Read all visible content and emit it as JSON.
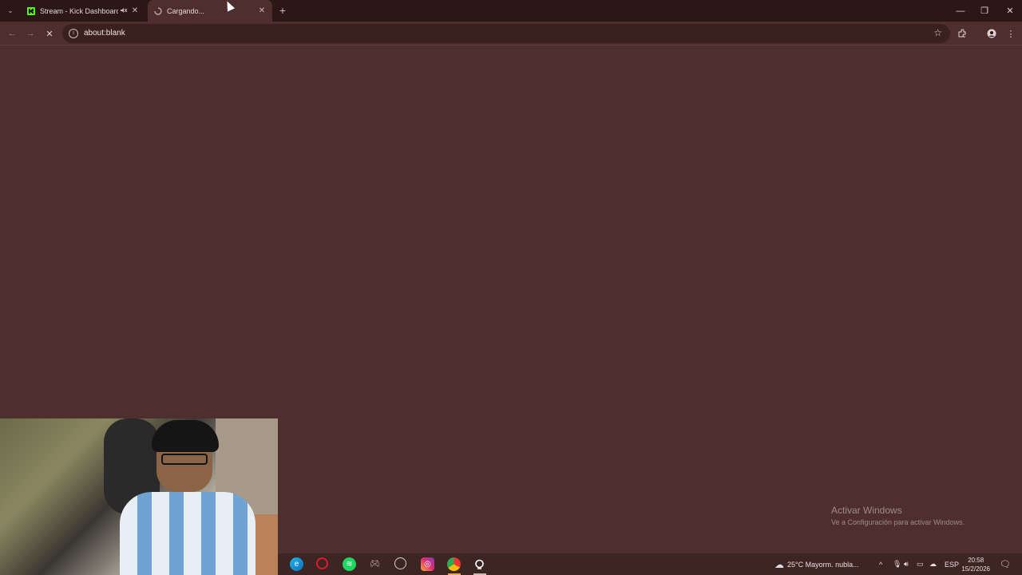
{
  "tabs": [
    {
      "title": "Stream - Kick Dashboard",
      "favicon": "kick-icon",
      "muted": true
    },
    {
      "title": "Cargando...",
      "favicon": "loading-spinner-icon",
      "active": true
    }
  ],
  "toolbar": {
    "url": "about:blank"
  },
  "watermark": {
    "title": "Activar Windows",
    "subtitle": "Ve a Configuración para activar Windows."
  },
  "taskbar": {
    "weather": "25°C  Mayorm. nubla...",
    "language": "ESP",
    "time": "20:58",
    "date": "15/2/2026"
  },
  "colors": {
    "page_bg": "#4f2e2e",
    "tabstrip_bg": "#2b1716",
    "kick_green": "#53fc18"
  }
}
